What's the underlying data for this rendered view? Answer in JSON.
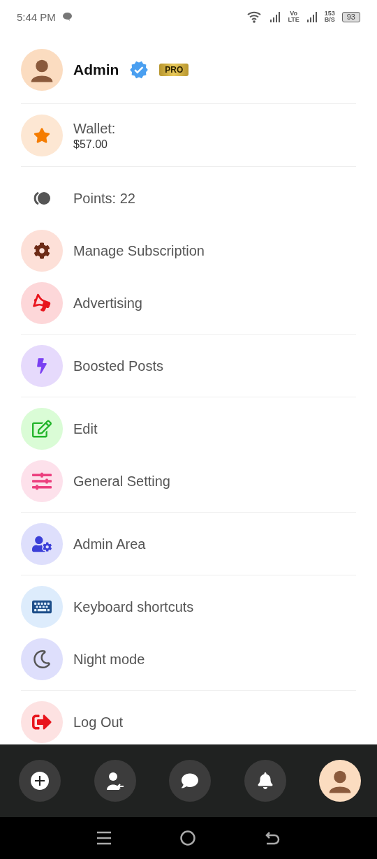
{
  "status_bar": {
    "time": "5:44 PM",
    "network_top": "Vo",
    "network_bottom": "LTE",
    "speed": "153",
    "speed_unit": "B/S",
    "battery": "93"
  },
  "sections": [
    {
      "items": [
        {
          "kind": "profile",
          "label": "Admin",
          "badge": "PRO",
          "verified": true,
          "color": "#fbdcc0"
        }
      ]
    },
    {
      "items": [
        {
          "kind": "wallet",
          "label": "Wallet:",
          "value": "$57.00",
          "color": "#fde7d3"
        }
      ]
    },
    {
      "items": [
        {
          "kind": "points",
          "label": "Points: 22"
        },
        {
          "kind": "subscription",
          "label": "Manage Subscription",
          "color": "#fde0d8"
        },
        {
          "kind": "advertising",
          "label": "Advertising",
          "color": "#fdd7d9"
        }
      ]
    },
    {
      "items": [
        {
          "kind": "boost",
          "label": "Boosted Posts",
          "color": "#e6dafc"
        }
      ]
    },
    {
      "items": [
        {
          "kind": "edit",
          "label": "Edit",
          "color": "#dafcd6"
        },
        {
          "kind": "settings",
          "label": "General Setting",
          "color": "#fde1eb"
        }
      ]
    },
    {
      "items": [
        {
          "kind": "admin",
          "label": "Admin Area",
          "color": "#dedffc"
        }
      ]
    },
    {
      "items": [
        {
          "kind": "keyboard",
          "label": "Keyboard shortcuts",
          "color": "#ddecfc"
        },
        {
          "kind": "night",
          "label": "Night mode",
          "color": "#dedffc"
        }
      ]
    },
    {
      "items": [
        {
          "kind": "logout",
          "label": "Log Out",
          "color": "#fde2e2"
        }
      ]
    }
  ],
  "bottom_bar": [
    {
      "kind": "create"
    },
    {
      "kind": "friends"
    },
    {
      "kind": "messages"
    },
    {
      "kind": "notifications"
    },
    {
      "kind": "profile"
    }
  ]
}
